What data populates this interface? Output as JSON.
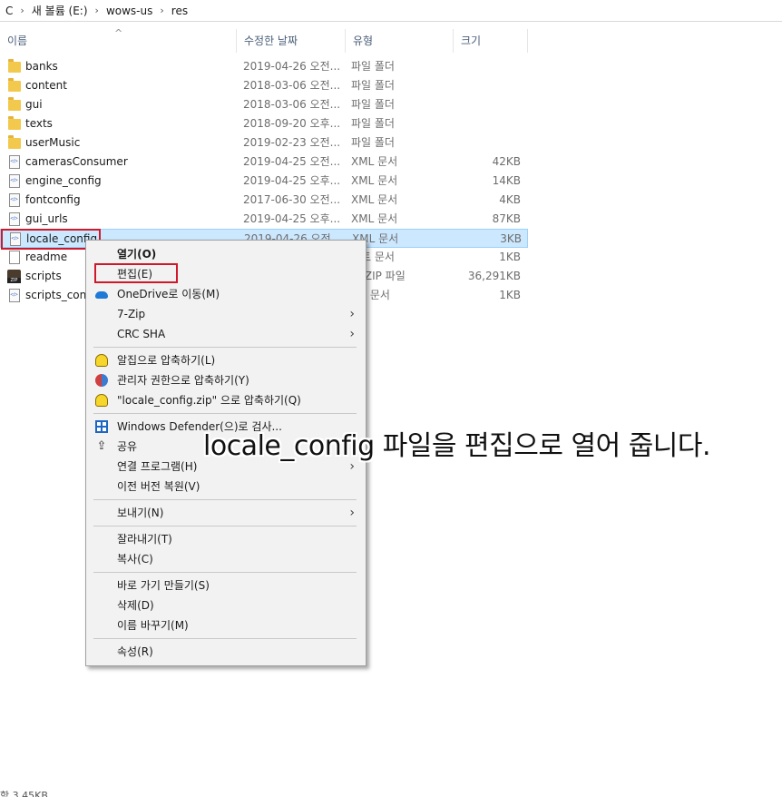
{
  "address_bar": {
    "crumbs": [
      "C",
      "새 볼륨 (E:)",
      "wows-us",
      "res"
    ]
  },
  "columns": {
    "name": "이름",
    "date": "수정한 날짜",
    "type": "유형",
    "size": "크기"
  },
  "files": [
    {
      "name": "banks",
      "date": "2019-04-26 오전...",
      "type": "파일 폴더",
      "size": "",
      "icon": "folder-icon"
    },
    {
      "name": "content",
      "date": "2018-03-06 오전...",
      "type": "파일 폴더",
      "size": "",
      "icon": "folder-icon"
    },
    {
      "name": "gui",
      "date": "2018-03-06 오전...",
      "type": "파일 폴더",
      "size": "",
      "icon": "folder-icon"
    },
    {
      "name": "texts",
      "date": "2018-09-20 오후...",
      "type": "파일 폴더",
      "size": "",
      "icon": "folder-icon"
    },
    {
      "name": "userMusic",
      "date": "2019-02-23 오전...",
      "type": "파일 폴더",
      "size": "",
      "icon": "folder-icon"
    },
    {
      "name": "camerasConsumer",
      "date": "2019-04-25 오전...",
      "type": "XML 문서",
      "size": "42KB",
      "icon": "xml-file-icon"
    },
    {
      "name": "engine_config",
      "date": "2019-04-25 오후...",
      "type": "XML 문서",
      "size": "14KB",
      "icon": "xml-file-icon"
    },
    {
      "name": "fontconfig",
      "date": "2017-06-30 오전...",
      "type": "XML 문서",
      "size": "4KB",
      "icon": "xml-file-icon"
    },
    {
      "name": "gui_urls",
      "date": "2019-04-25 오후...",
      "type": "XML 문서",
      "size": "87KB",
      "icon": "xml-file-icon"
    },
    {
      "name": "locale_config",
      "date": "2019-04-26 오전...",
      "type": "XML 문서",
      "size": "3KB",
      "icon": "xml-file-icon",
      "selected": true
    },
    {
      "name": "readme",
      "date": "",
      "type": "스트 문서",
      "size": "1KB",
      "icon": "text-file-icon"
    },
    {
      "name": "scripts",
      "date": "",
      "type": "집 ZIP 파일",
      "size": "36,291KB",
      "icon": "zip-file-icon"
    },
    {
      "name": "scripts_confi",
      "date": "",
      "type": "ML 문서",
      "size": "1KB",
      "icon": "xml-file-icon"
    }
  ],
  "context_menu": {
    "items": [
      {
        "label": "열기(O)",
        "bold": true
      },
      {
        "label": "편집(E)"
      },
      {
        "label": "OneDrive로 이동(M)",
        "icon": "onedrive-cloud-icon"
      },
      {
        "label": "7-Zip",
        "submenu": true
      },
      {
        "label": "CRC SHA",
        "submenu": true
      },
      {
        "separator": true
      },
      {
        "label": "알집으로 압축하기(L)",
        "icon": "alzip-icon"
      },
      {
        "label": "관리자 권한으로 압축하기(Y)",
        "icon": "admin-shield-icon"
      },
      {
        "label": "\"locale_config.zip\" 으로 압축하기(Q)",
        "icon": "alzip-icon"
      },
      {
        "separator": true
      },
      {
        "label": "Windows Defender(으)로 검사...",
        "icon": "windows-defender-icon"
      },
      {
        "label": "공유",
        "icon": "share-icon"
      },
      {
        "label": "연결 프로그램(H)",
        "submenu": true
      },
      {
        "label": "이전 버전 복원(V)"
      },
      {
        "separator": true
      },
      {
        "label": "보내기(N)",
        "submenu": true
      },
      {
        "separator": true
      },
      {
        "label": "잘라내기(T)"
      },
      {
        "label": "복사(C)"
      },
      {
        "separator": true
      },
      {
        "label": "바로 가기 만들기(S)"
      },
      {
        "label": "삭제(D)"
      },
      {
        "label": "이름 바꾸기(M)"
      },
      {
        "separator": true
      },
      {
        "label": "속성(R)"
      }
    ]
  },
  "caption": "locale_config 파일을 편집으로 열어 줍니다.",
  "status_bar": "함 3.45KB",
  "colors": {
    "selection_bg": "#cce8ff",
    "selection_border": "#99d1ff",
    "highlight_red": "#d0182b",
    "menu_bg": "#f2f2f2",
    "header_text": "#4c607a"
  }
}
